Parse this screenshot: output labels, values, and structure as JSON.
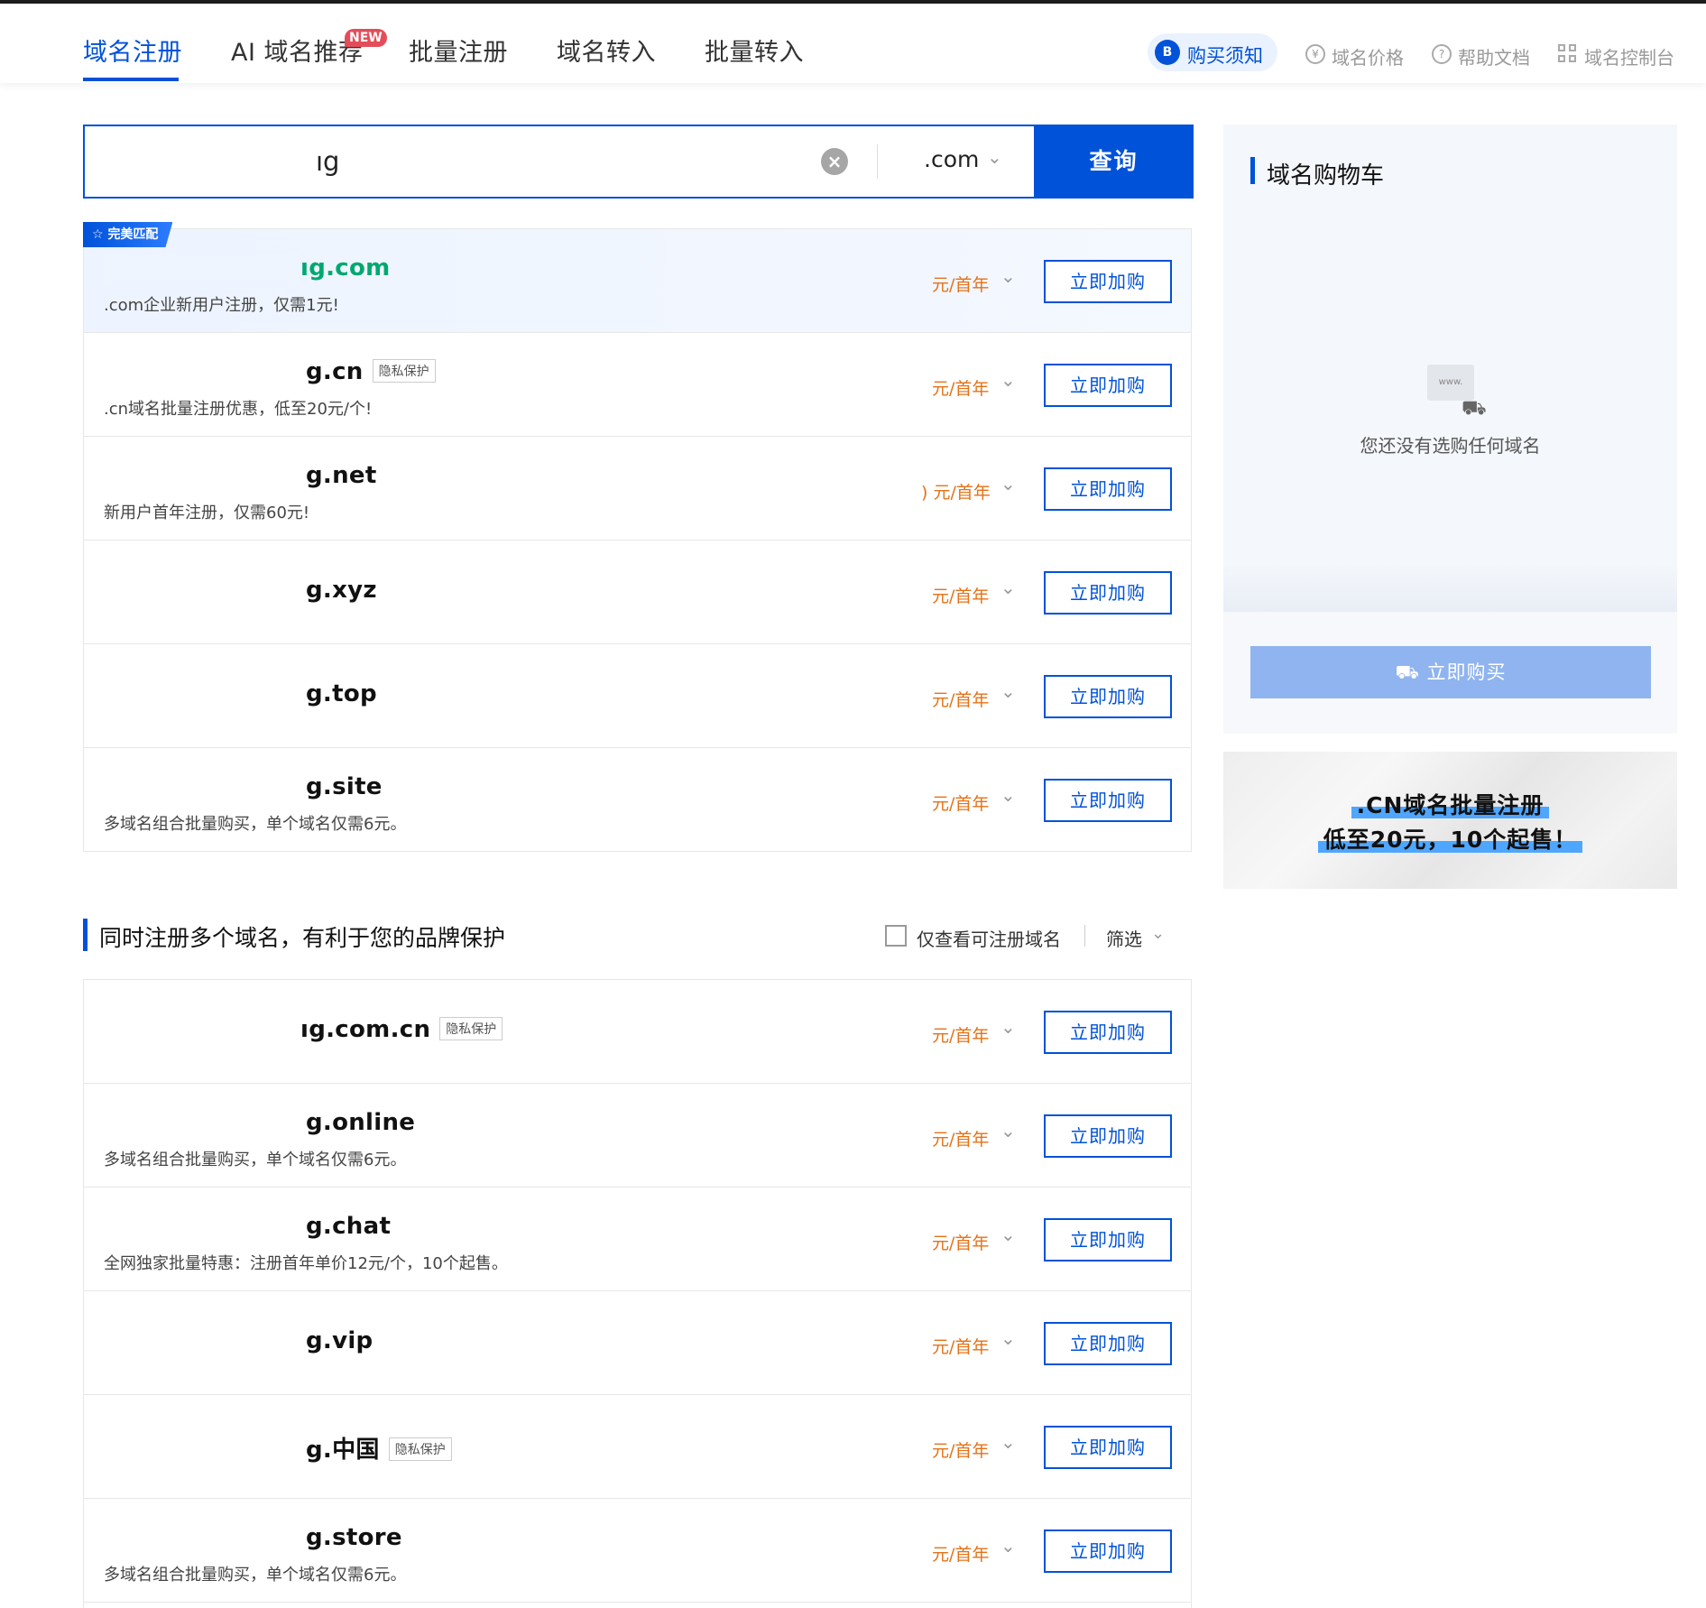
{
  "nav": {
    "tabs": [
      {
        "label": "域名注册"
      },
      {
        "label": "AI 域名推荐"
      },
      {
        "label": "批量注册"
      },
      {
        "label": "域名转入"
      },
      {
        "label": "批量转入"
      }
    ],
    "new_badge": "NEW",
    "notice_label": "购买须知",
    "tools": [
      {
        "label": "域名价格",
        "icon": "yen-circle-icon"
      },
      {
        "label": "帮助文档",
        "icon": "question-circle-icon"
      },
      {
        "label": "域名控制台",
        "icon": "grid-icon"
      }
    ]
  },
  "search": {
    "value": "ıg",
    "suffix": ".com",
    "button": "查询"
  },
  "perfect_match_label": "完美匹配",
  "privacy_label": "隐私保护",
  "add_label": "立即加购",
  "price_unit": "元/首年",
  "results": [
    {
      "name": "ıg.com",
      "desc": ".com企业新用户注册，仅需1元!",
      "price": "元/首年"
    },
    {
      "name": "g.cn",
      "desc": ".cn域名批量注册优惠，低至20元/个!",
      "price": "元/首年",
      "privacy": true
    },
    {
      "name": "g.net",
      "desc": "新用户首年注册，仅需60元!",
      "price": ") 元/首年"
    },
    {
      "name": "g.xyz",
      "desc": "",
      "price": "元/首年"
    },
    {
      "name": "g.top",
      "desc": "",
      "price": "元/首年"
    },
    {
      "name": "g.site",
      "desc": "多域名组合批量购买，单个域名仅需6元。",
      "price": "元/首年"
    }
  ],
  "section2": {
    "title": "同时注册多个域名，有利于您的品牌保护",
    "checkbox_label": "仅查看可注册域名",
    "filter_label": "筛选"
  },
  "results2": [
    {
      "name": "ıg.com.cn",
      "desc": "",
      "price": "元/首年",
      "privacy": true
    },
    {
      "name": "g.online",
      "desc": "多域名组合批量购买，单个域名仅需6元。",
      "price": "元/首年"
    },
    {
      "name": "g.chat",
      "desc": "全网独家批量特惠：注册首年单价12元/个，10个起售。",
      "price": "元/首年"
    },
    {
      "name": "g.vip",
      "desc": "",
      "price": "元/首年"
    },
    {
      "name": "g.中国",
      "desc": "",
      "price": "元/首年",
      "privacy": true
    },
    {
      "name": "g.store",
      "desc": "多域名组合批量购买，单个域名仅需6元。",
      "price": "元/首年"
    }
  ],
  "cart": {
    "title": "域名购物车",
    "empty_text": "您还没有选购任何域名",
    "empty_icon_text": "www.",
    "buy_label": "立即购买"
  },
  "banner": {
    "line1": ".CN域名批量注册",
    "line2": "低至20元，10个起售！"
  },
  "colors": {
    "accent": "#0052d9",
    "price": "#e37318",
    "match": "#00a870"
  }
}
